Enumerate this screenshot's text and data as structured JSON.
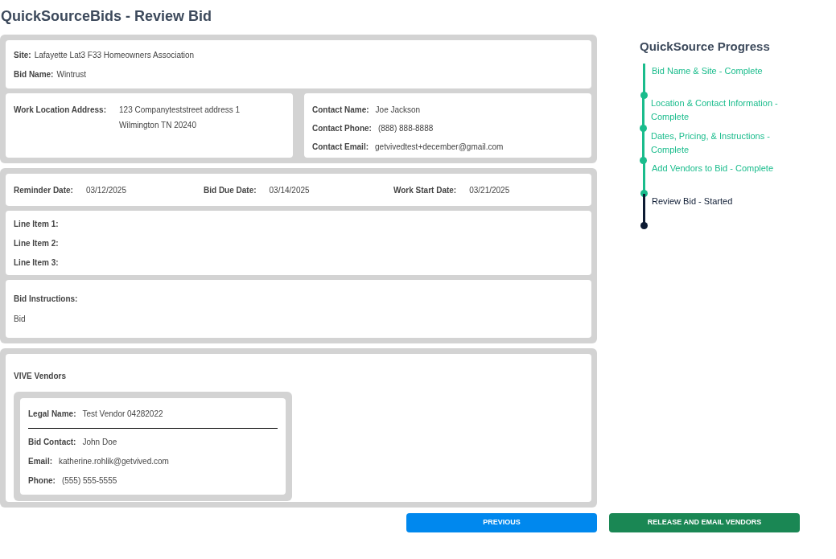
{
  "title": "QuickSourceBids - Review Bid",
  "site": {
    "label": "Site:",
    "value": "Lafayette Lat3 F33 Homeowners Association"
  },
  "bid_name": {
    "label": "Bid Name:",
    "value": "Wintrust"
  },
  "address": {
    "label": "Work Location Address:",
    "lines": [
      "123 Companyteststreet address 1",
      "Wilmington TN 20240"
    ]
  },
  "contact": [
    {
      "label": "Contact Name:",
      "value": "Joe Jackson"
    },
    {
      "label": "Contact Phone:",
      "value": "(888) 888-8888"
    },
    {
      "label": "Contact Email:",
      "value": "getvivedtest+december@gmail.com"
    }
  ],
  "dates": [
    {
      "label": "Reminder Date:",
      "value": "03/12/2025"
    },
    {
      "label": "Bid Due Date:",
      "value": "03/14/2025"
    },
    {
      "label": "Work Start Date:",
      "value": "03/21/2025"
    }
  ],
  "line_items": [
    "Line Item 1:",
    "Line Item 2:",
    "Line Item 3:"
  ],
  "instructions": {
    "label": "Bid Instructions:",
    "value": "Bid"
  },
  "vendors": {
    "title": "VIVE Vendors",
    "items": [
      {
        "legal_label": "Legal Name:",
        "legal_name": "Test Vendor 04282022",
        "fields": [
          {
            "label": "Bid Contact:",
            "value": "John Doe"
          },
          {
            "label": "Email:",
            "value": "katherine.rohlik@getvived.com"
          },
          {
            "label": "Phone:",
            "value": "(555) 555-5555"
          }
        ]
      }
    ]
  },
  "buttons": [
    {
      "label": "PREVIOUS",
      "kind": "secondary"
    },
    {
      "label": "RELEASE AND EMAIL VENDORS",
      "kind": "primary"
    }
  ],
  "progress": {
    "title": "QuickSource Progress",
    "steps": [
      {
        "label": "Bid Name & Site - Complete",
        "complete": true
      },
      {
        "label": "Location & Contact Information - Complete",
        "complete": true
      },
      {
        "label": "Dates, Pricing, & Instructions - Complete",
        "complete": true
      },
      {
        "label": "Add Vendors to Bid - Complete",
        "complete": true
      },
      {
        "label": "Review Bid - Started",
        "complete": false
      }
    ]
  }
}
